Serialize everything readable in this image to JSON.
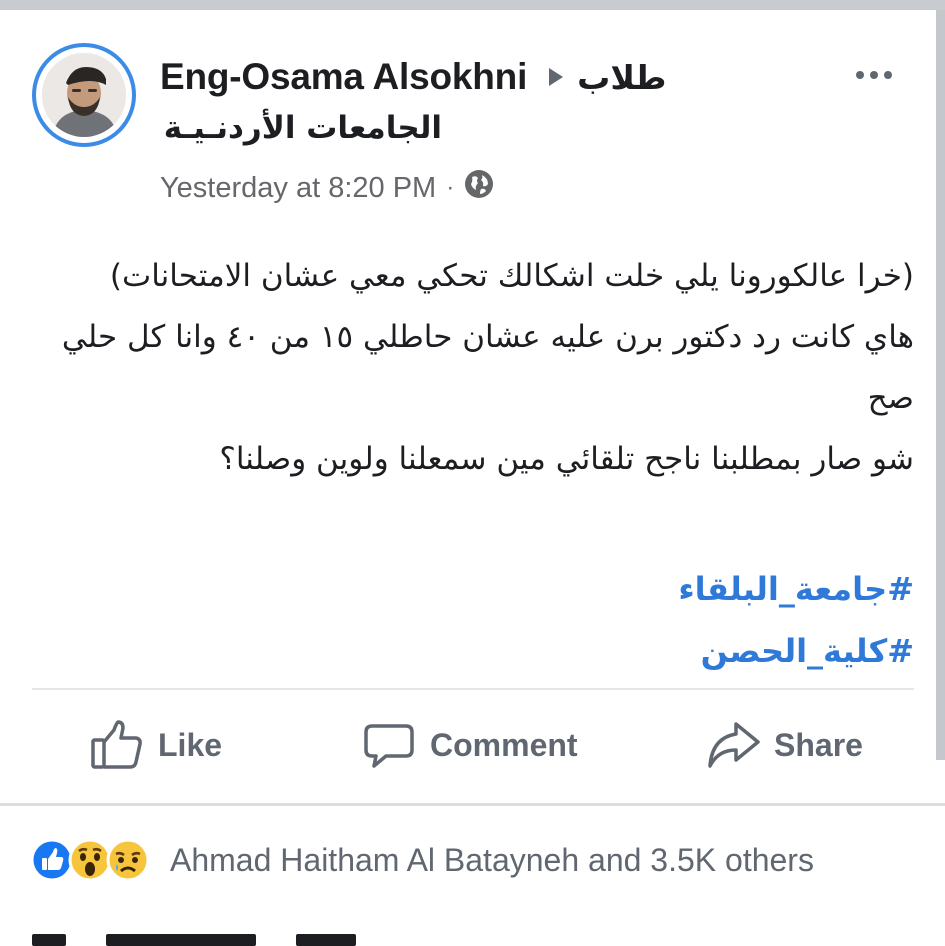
{
  "post": {
    "author": {
      "name": "Eng-Osama Alsokhni",
      "avatar": "profile-photo"
    },
    "group": {
      "name_line_1": "طلاب",
      "name_line_2": "الجامعات الأردنـيـة"
    },
    "meta": {
      "timestamp": "Yesterday at 8:20 PM",
      "separator": "·",
      "privacy_icon": "globe-icon"
    },
    "more_icon": "more-options-icon",
    "text_lines": [
      "(خرا عالكورونا يلي خلت اشكالك تحكي معي عشان الامتحانات)",
      "هاي كانت رد دكتور برن عليه عشان حاطلي ١٥ من ٤٠ وانا كل حلي صح",
      "شو صار بمطلبنا ناجح تلقائي  مين سمعلنا ولوين وصلنا؟"
    ],
    "hashtags": [
      "#جامعة_البلقاء",
      "#كلية_الحصن"
    ]
  },
  "actions": {
    "like_label": "Like",
    "comment_label": "Comment",
    "share_label": "Share"
  },
  "reactions": {
    "types": [
      "like-reaction-icon",
      "wow-reaction-icon",
      "sad-reaction-icon"
    ],
    "summary": "Ahmad Haitham Al Batayneh and 3.5K others"
  },
  "colors": {
    "text_primary": "#1c1e21",
    "text_secondary": "#65676b",
    "link_blue": "#2f79d8",
    "avatar_ring": "#3c8ce7",
    "like_blue": "#1877f2"
  }
}
